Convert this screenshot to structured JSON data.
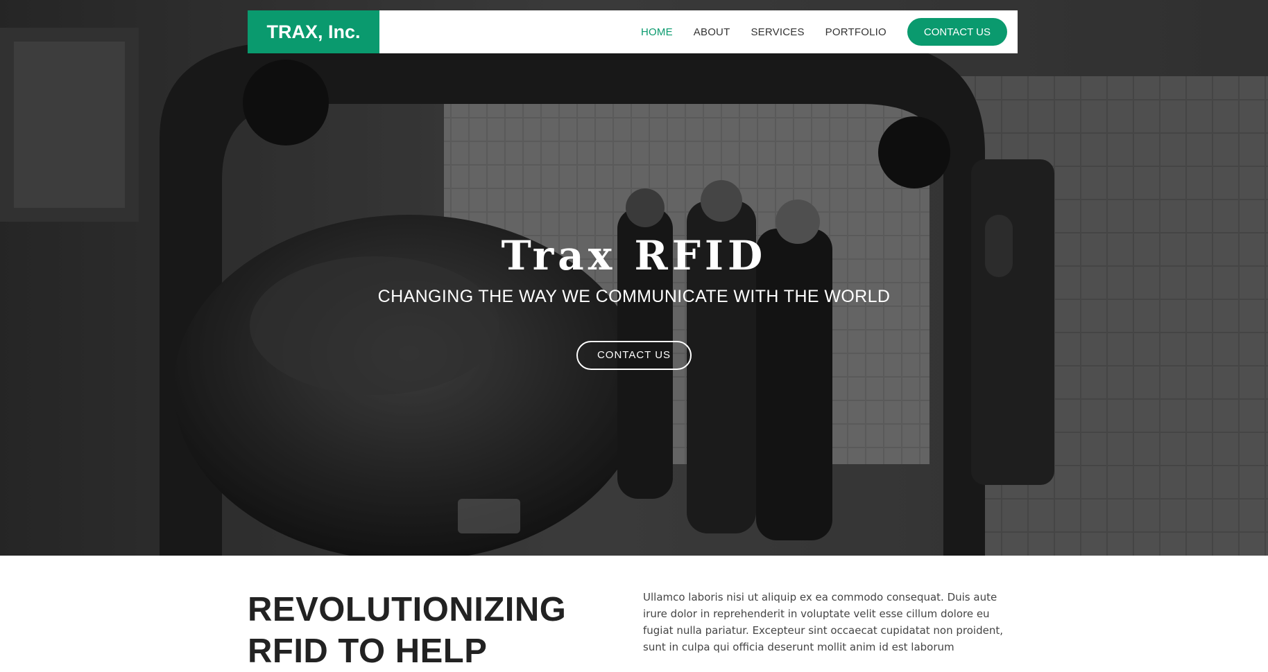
{
  "nav": {
    "brand": "TRAX, Inc.",
    "links": [
      {
        "label": "HOME",
        "active": true
      },
      {
        "label": "ABOUT",
        "active": false
      },
      {
        "label": "SERVICES",
        "active": false
      },
      {
        "label": "PORTFOLIO",
        "active": false
      }
    ],
    "cta_label": "CONTACT US"
  },
  "hero": {
    "title": "Trax RFID",
    "subtitle": "CHANGING THE WAY WE COMMUNICATE WITH THE WORLD",
    "cta_label": "CONTACT US"
  },
  "intro": {
    "heading": "REVOLUTIONIZING RFID TO HELP",
    "body": "Ullamco laboris nisi ut aliquip ex ea commodo consequat. Duis aute irure dolor in reprehenderit in voluptate velit esse cillum dolore eu fugiat nulla pariatur. Excepteur sint occaecat cupidatat non proident, sunt in culpa qui officia deserunt mollit anim id est laborum"
  },
  "colors": {
    "accent": "#0a9a6e",
    "nav_text": "#333333",
    "heading": "#222222",
    "body_text": "#444444",
    "hero_overlay": "#000000"
  }
}
